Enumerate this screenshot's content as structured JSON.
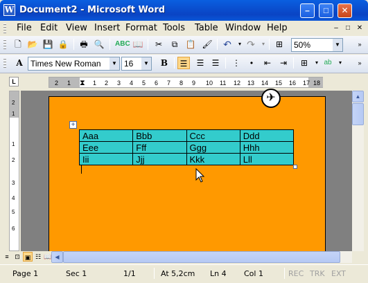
{
  "window": {
    "title": "Document2 - Microsoft Word",
    "app_icon": "W",
    "minimize": "–",
    "maximize": "□",
    "close": "✕"
  },
  "menubar": {
    "items": [
      "File",
      "Edit",
      "View",
      "Insert",
      "Format",
      "Tools",
      "Table",
      "Window",
      "Help"
    ],
    "doc_controls": [
      "–",
      "□",
      "✕"
    ]
  },
  "toolbar_standard": {
    "icons": [
      "new-icon",
      "open-icon",
      "save-icon",
      "permission-icon",
      "print-icon",
      "print-preview-icon",
      "spelling-icon",
      "research-icon",
      "cut-icon",
      "copy-icon",
      "paste-icon",
      "format-painter-icon",
      "undo-icon",
      "redo-icon",
      "insert-table-icon"
    ],
    "zoom": "50%"
  },
  "toolbar_formatting": {
    "style_icon": "A",
    "font": "Times New Roman",
    "font_size": "16",
    "bold": "B",
    "align_left_active": true
  },
  "ruler": {
    "tab_selector": "L",
    "h_labels": [
      "2",
      "1",
      "1",
      "2",
      "3",
      "4",
      "5",
      "6",
      "7",
      "8",
      "9",
      "10",
      "11",
      "12",
      "13",
      "14",
      "15",
      "16",
      "17",
      "18"
    ],
    "v_labels": [
      "2",
      "1",
      "1",
      "2",
      "3",
      "4",
      "5",
      "6"
    ]
  },
  "document": {
    "page_color": "#ff9900",
    "table_color": "#33cccc",
    "table": [
      [
        "Aaa",
        "Bbb",
        "Ccc",
        "Ddd"
      ],
      [
        "Eee",
        "Fff",
        "Ggg",
        "Hhh"
      ],
      [
        "Iii",
        "Jjj",
        "Kkk",
        "Lll"
      ]
    ]
  },
  "statusbar": {
    "page": "Page 1",
    "section": "Sec 1",
    "page_of": "1/1",
    "at": "At 5,2cm",
    "line": "Ln 4",
    "col": "Col 1",
    "rec": "REC",
    "trk": "TRK",
    "ext": "EXT"
  }
}
